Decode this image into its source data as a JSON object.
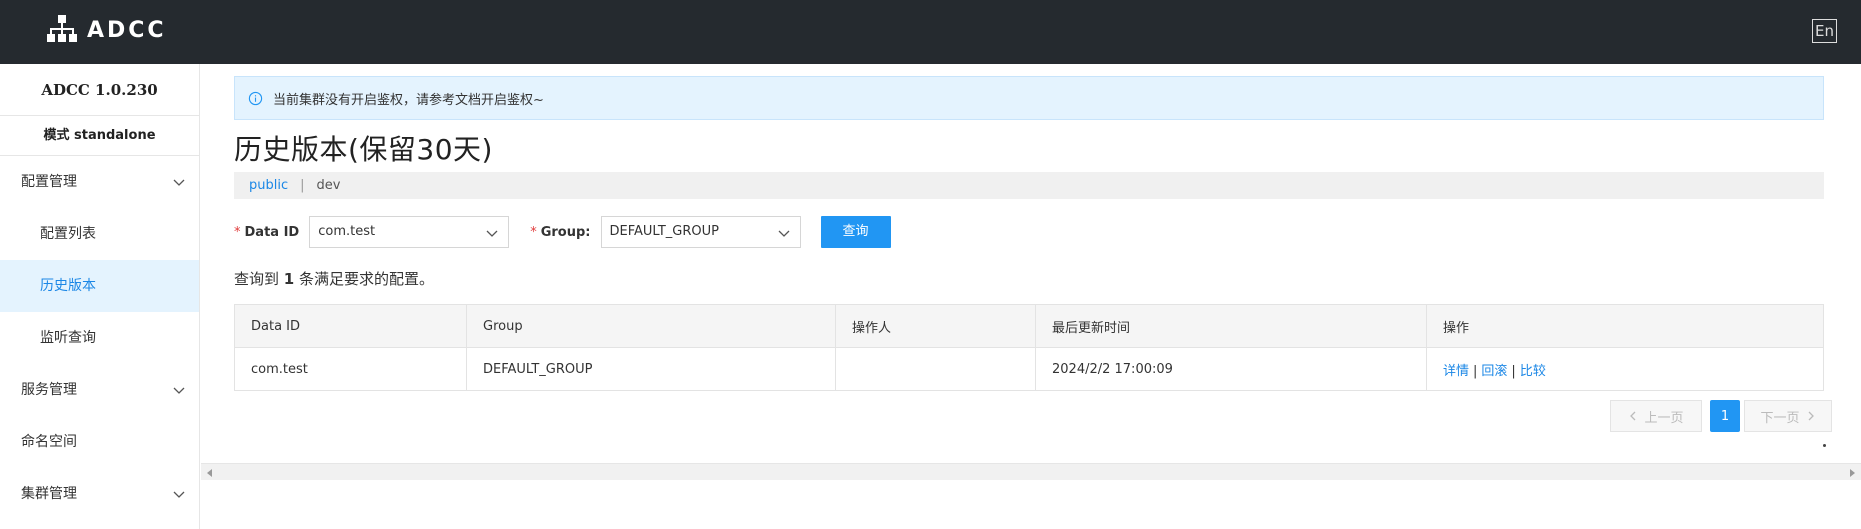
{
  "header": {
    "logo_text": "ADCC",
    "lang_toggle": "En"
  },
  "sidebar": {
    "version": "ADCC 1.0.230",
    "mode": "模式 standalone",
    "items": [
      {
        "label": "配置管理",
        "expandable": true
      },
      {
        "label": "配置列表",
        "sub": true
      },
      {
        "label": "历史版本",
        "sub": true,
        "active": true
      },
      {
        "label": "监听查询",
        "sub": true
      },
      {
        "label": "服务管理",
        "expandable": true
      },
      {
        "label": "命名空间"
      },
      {
        "label": "集群管理",
        "expandable": true
      }
    ]
  },
  "main": {
    "notice": "当前集群没有开启鉴权，请参考文档开启鉴权~",
    "title": "历史版本(保留30天)",
    "namespaces": {
      "active": "public",
      "separator": "|",
      "other": "dev"
    },
    "filters": {
      "data_id_label": "Data ID",
      "data_id_value": "com.test",
      "group_label": "Group:",
      "group_value": "DEFAULT_GROUP",
      "required_mark": "*",
      "query_button": "查询"
    },
    "result": {
      "prefix": "查询到",
      "count": "1",
      "suffix": "条满足要求的配置。"
    },
    "table": {
      "columns": [
        "Data ID",
        "Group",
        "操作人",
        "最后更新时间",
        "操作"
      ],
      "rows": [
        {
          "data_id": "com.test",
          "group": "DEFAULT_GROUP",
          "operator": "",
          "updated": "2024/2/2 17:00:09",
          "actions": [
            "详情",
            "回滚",
            "比较"
          ]
        }
      ]
    },
    "pagination": {
      "prev": "上一页",
      "current": "1",
      "next": "下一页"
    }
  },
  "colors": {
    "header_bg": "#252a2f",
    "primary": "#2196f3",
    "link": "#1b87e6",
    "active_bg": "#e4f3fe"
  }
}
